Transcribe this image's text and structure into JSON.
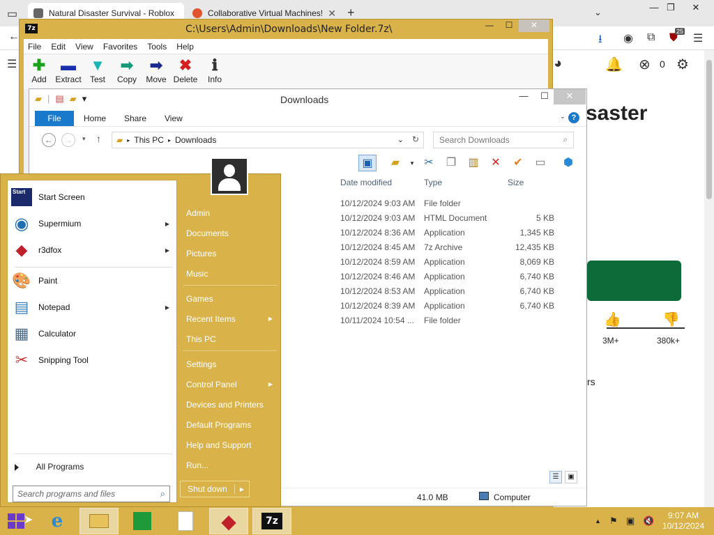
{
  "browser": {
    "tabs": [
      {
        "label": "Natural Disaster Survival - Roblox",
        "close": "✕"
      },
      {
        "label": "Collaborative Virtual Machines!",
        "close": "✕"
      }
    ],
    "new_tab": "+",
    "win_controls": {
      "min": "—",
      "max": "❐",
      "close": "✕"
    },
    "badge_count": "25",
    "page_title_fragment": "saster",
    "notif_count": "0",
    "likes": "3M+",
    "dislikes": "380k+",
    "partial_text": "rs"
  },
  "sevenzip": {
    "title": "C:\\Users\\Admin\\Downloads\\New Folder.7z\\",
    "icon_text": "7z",
    "menu": [
      "File",
      "Edit",
      "View",
      "Favorites",
      "Tools",
      "Help"
    ],
    "tools": [
      {
        "label": "Add",
        "glyph": "✚",
        "color": "#1aa31a"
      },
      {
        "label": "Extract",
        "glyph": "▬",
        "color": "#1a2fb0"
      },
      {
        "label": "Test",
        "glyph": "▼",
        "color": "#19b5b5"
      },
      {
        "label": "Copy",
        "glyph": "➡",
        "color": "#129a7a"
      },
      {
        "label": "Move",
        "glyph": "➡",
        "color": "#1a2a90"
      },
      {
        "label": "Delete",
        "glyph": "✖",
        "color": "#d42020"
      },
      {
        "label": "Info",
        "glyph": "ℹ",
        "color": "#333333"
      }
    ]
  },
  "explorer": {
    "title": "Downloads",
    "ribbon_tabs": [
      "File",
      "Home",
      "Share",
      "View"
    ],
    "help": "?",
    "path": [
      "This PC",
      "Downloads"
    ],
    "search_placeholder": "Search Downloads",
    "columns": {
      "date": "Date modified",
      "type": "Type",
      "size": "Size"
    },
    "rows": [
      {
        "date": "10/12/2024 9:03 AM",
        "type": "File folder",
        "size": ""
      },
      {
        "date": "10/12/2024 9:03 AM",
        "type": "HTML Document",
        "size": "5 KB"
      },
      {
        "date": "10/12/2024 8:36 AM",
        "type": "Application",
        "size": "1,345 KB"
      },
      {
        "date": "10/12/2024 8:45 AM",
        "type": "7z Archive",
        "size": "12,435 KB"
      },
      {
        "date": "10/12/2024 8:59 AM",
        "type": "Application",
        "size": "8,069 KB"
      },
      {
        "date": "10/12/2024 8:46 AM",
        "type": "Application",
        "size": "6,740 KB"
      },
      {
        "date": "10/12/2024 8:53 AM",
        "type": "Application",
        "size": "6,740 KB"
      },
      {
        "date": "10/12/2024 8:39 AM",
        "type": "Application",
        "size": "6,740 KB"
      },
      {
        "date": "10/11/2024 10:54 ...",
        "type": "File folder",
        "size": ""
      }
    ],
    "status_size": "41.0 MB",
    "status_location": "Computer"
  },
  "start_menu": {
    "pinned": [
      {
        "label": "Start Screen",
        "has_arrow": false
      },
      {
        "label": "Supermium",
        "has_arrow": true
      },
      {
        "label": "r3dfox",
        "has_arrow": true
      },
      {
        "label": "Paint",
        "has_arrow": false
      },
      {
        "label": "Notepad",
        "has_arrow": true
      },
      {
        "label": "Calculator",
        "has_arrow": false
      },
      {
        "label": "Snipping Tool",
        "has_arrow": false
      }
    ],
    "start_icon_text": "Start",
    "all_programs": "All Programs",
    "search_placeholder": "Search programs and files",
    "right_items": [
      {
        "label": "Admin",
        "arrow": false
      },
      {
        "label": "Documents",
        "arrow": false
      },
      {
        "label": "Pictures",
        "arrow": false
      },
      {
        "label": "Music",
        "arrow": false
      },
      {
        "label": "Games",
        "arrow": false
      },
      {
        "label": "Recent Items",
        "arrow": true
      },
      {
        "label": "This PC",
        "arrow": false
      },
      {
        "label": "Settings",
        "arrow": false
      },
      {
        "label": "Control Panel",
        "arrow": true
      },
      {
        "label": "Devices and Printers",
        "arrow": false
      },
      {
        "label": "Default Programs",
        "arrow": false
      },
      {
        "label": "Help and Support",
        "arrow": false
      },
      {
        "label": "Run...",
        "arrow": false
      }
    ],
    "shutdown": "Shut down"
  },
  "taskbar": {
    "time": "9:07 AM",
    "date": "10/12/2024",
    "sevenzip_icon": "7z",
    "accent": "#d9b349"
  }
}
